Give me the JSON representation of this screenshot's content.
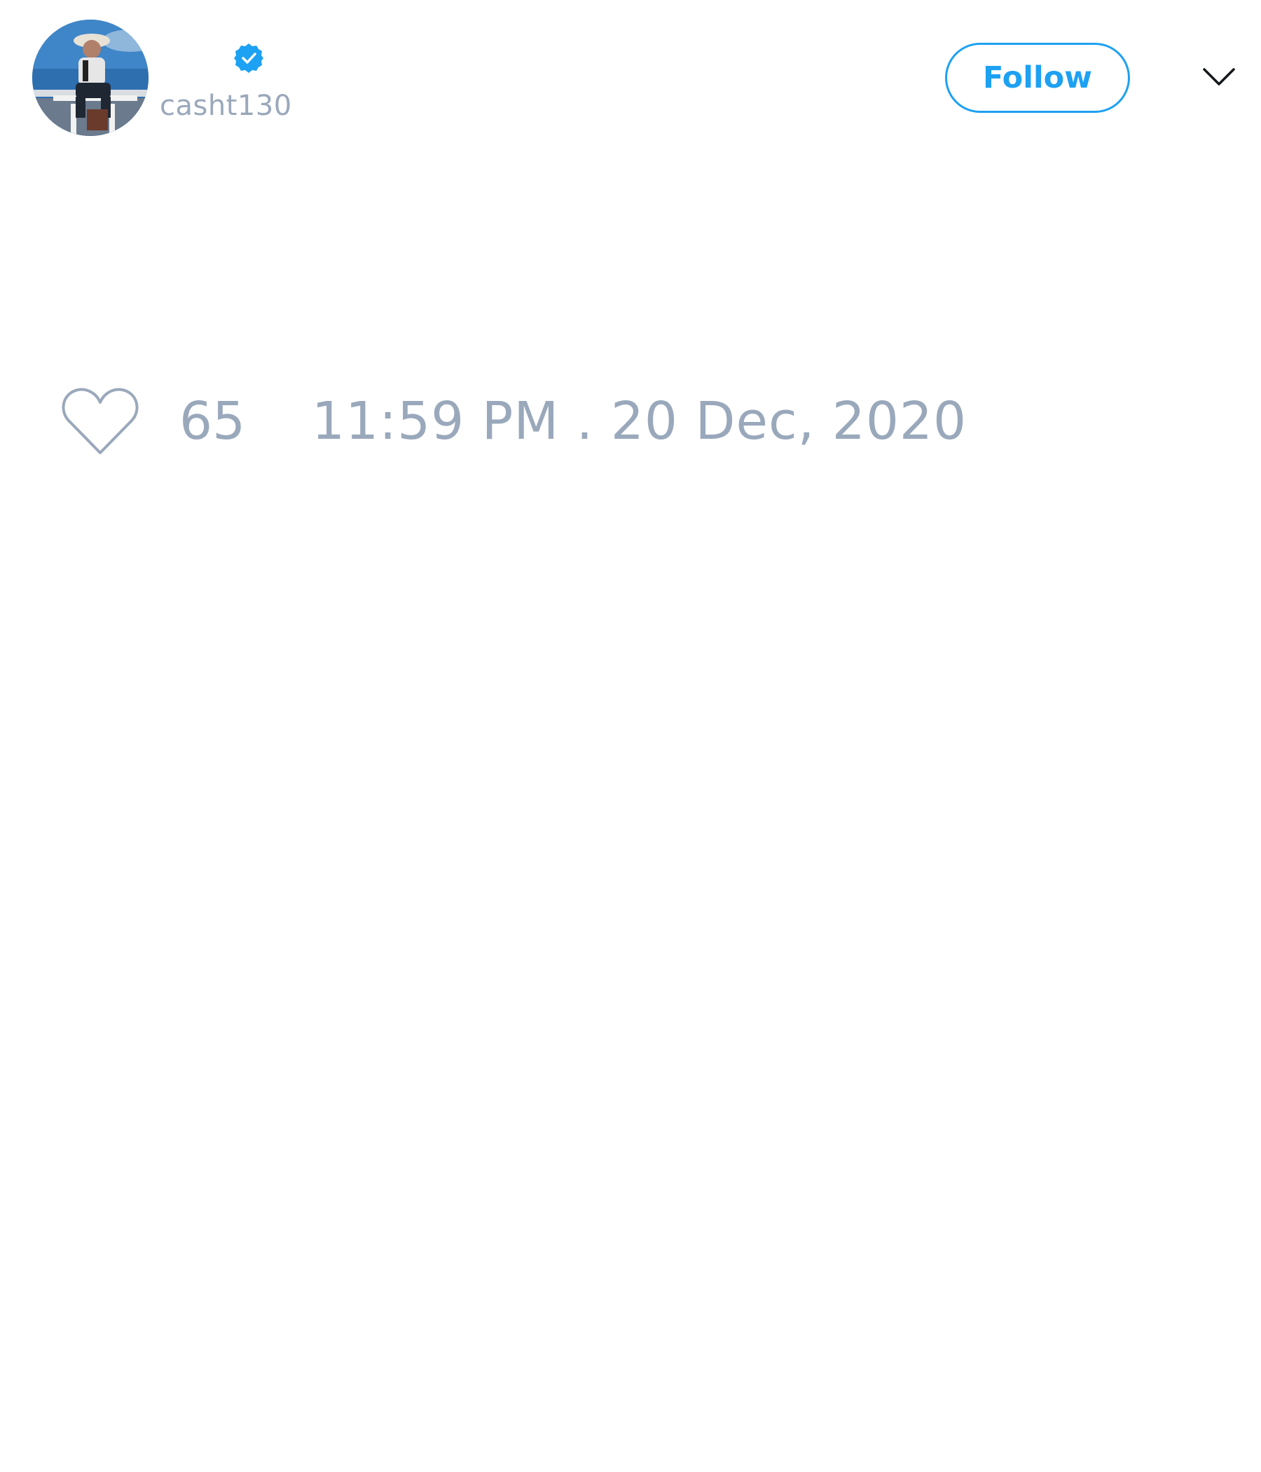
{
  "tweet": {
    "author": {
      "display_name": "",
      "username": "casht130",
      "verified": true,
      "avatar": "avatar-photo"
    },
    "follow_button": {
      "label": "Follow"
    },
    "menu_icon": "chevron-down-icon",
    "likes": {
      "icon": "heart-icon",
      "count": "65"
    },
    "timestamp": "11:59 PM . 20 Dec, 2020"
  },
  "colors": {
    "accent": "#1da1f2",
    "muted_text": "#9aa8bb",
    "background": "#ffffff"
  }
}
